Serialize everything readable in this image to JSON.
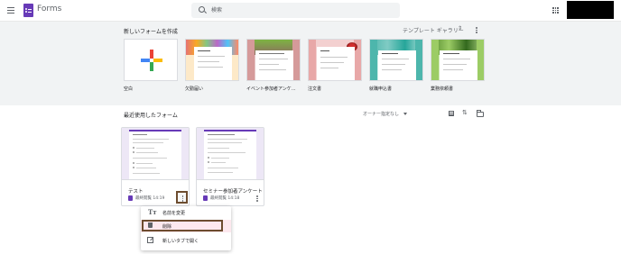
{
  "header": {
    "app_title": "Forms",
    "search_placeholder": "検索"
  },
  "gallery": {
    "title": "新しいフォームを作成",
    "template_gallery_label": "テンプレート ギャラリー",
    "templates": [
      {
        "label": "空白"
      },
      {
        "label": "欠勤届い"
      },
      {
        "label": "イベント参加者アンケ..."
      },
      {
        "label": "注文書"
      },
      {
        "label": "就職申込書"
      },
      {
        "label": "業務依頼書"
      }
    ]
  },
  "recent": {
    "title": "最近使用したフォーム",
    "owner_filter": "オーナー指定なし",
    "cards": [
      {
        "title": "テスト",
        "meta": "最終閲覧 14:19"
      },
      {
        "title": "セミナー参加者アンケート",
        "meta": "最終閲覧 14:18"
      }
    ]
  },
  "context_menu": {
    "rename_label": "名前を変更",
    "delete_label": "削除",
    "open_new_tab_label": "新しいタブで開く"
  },
  "colors": {
    "forms_purple": "#673ab7",
    "gallery_bg": "#f1f3f4",
    "highlight_outline": "#6d4c2f",
    "delete_highlight_bg": "#fde8ee"
  }
}
